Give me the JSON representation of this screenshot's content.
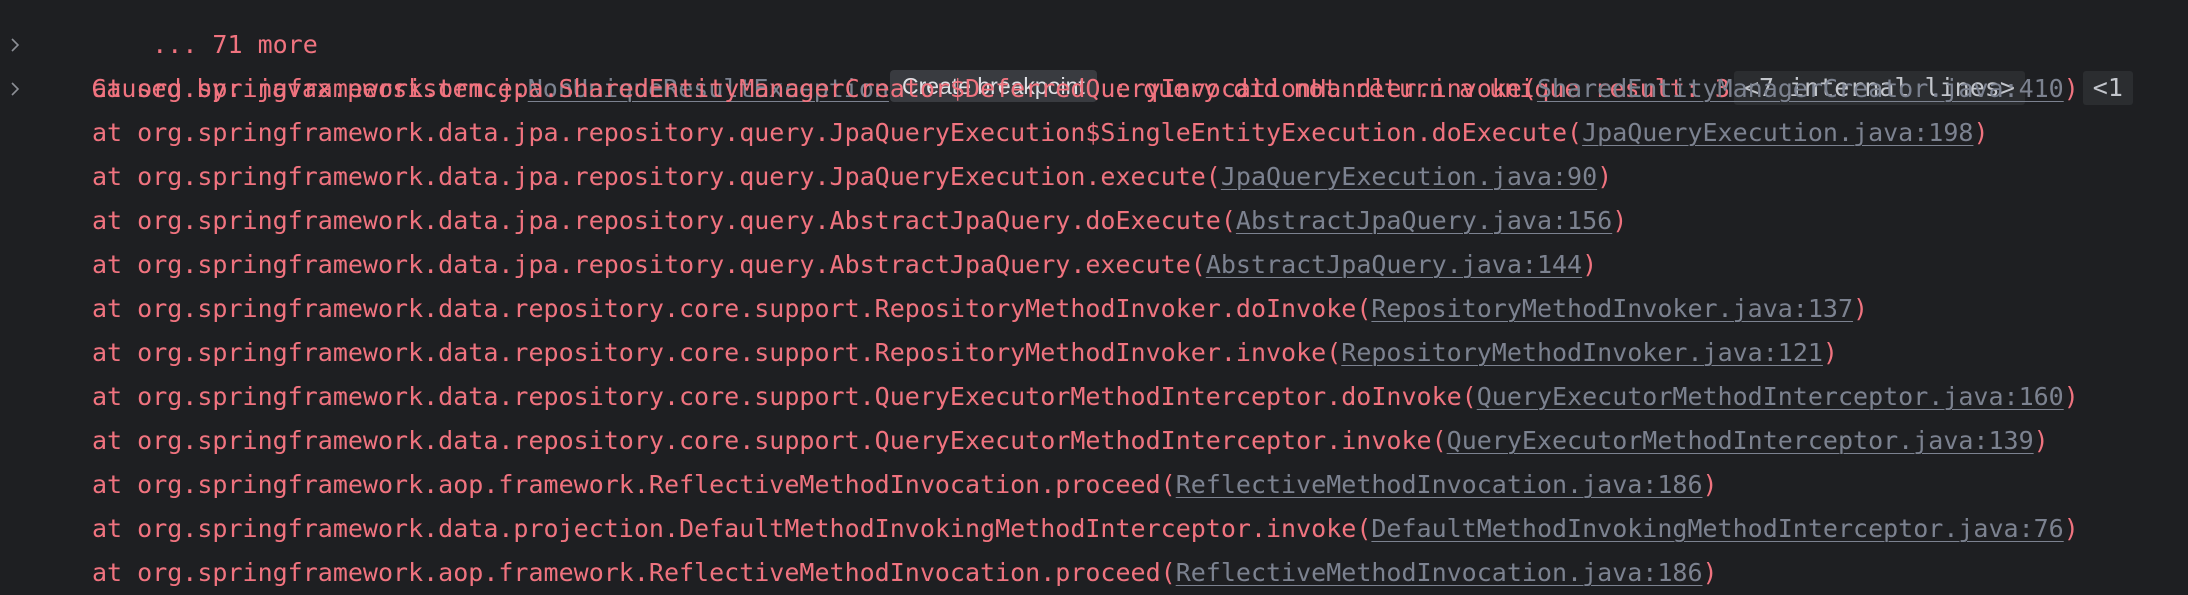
{
  "more_line": "... 71 more",
  "caused_by": {
    "prefix": "Caused by: javax.persistence.",
    "exception_link": "NonUniqueResultException",
    "tooltip": "Create breakpoint",
    "message": " : query did not return a unique result: 3",
    "internal_lines": "<7 internal lines>"
  },
  "frames": [
    {
      "method": "at org.springframework.orm.jpa.SharedEntityManagerCreator$DeferredQueryInvocationHandler.invoke",
      "location": "SharedEntityManagerCreator.java:410",
      "trailing": "<1"
    },
    {
      "method": "at org.springframework.data.jpa.repository.query.JpaQueryExecution$SingleEntityExecution.doExecute",
      "location": "JpaQueryExecution.java:198"
    },
    {
      "method": "at org.springframework.data.jpa.repository.query.JpaQueryExecution.execute",
      "location": "JpaQueryExecution.java:90"
    },
    {
      "method": "at org.springframework.data.jpa.repository.query.AbstractJpaQuery.doExecute",
      "location": "AbstractJpaQuery.java:156"
    },
    {
      "method": "at org.springframework.data.jpa.repository.query.AbstractJpaQuery.execute",
      "location": "AbstractJpaQuery.java:144"
    },
    {
      "method": "at org.springframework.data.repository.core.support.RepositoryMethodInvoker.doInvoke",
      "location": "RepositoryMethodInvoker.java:137"
    },
    {
      "method": "at org.springframework.data.repository.core.support.RepositoryMethodInvoker.invoke",
      "location": "RepositoryMethodInvoker.java:121"
    },
    {
      "method": "at org.springframework.data.repository.core.support.QueryExecutorMethodInterceptor.doInvoke",
      "location": "QueryExecutorMethodInterceptor.java:160"
    },
    {
      "method": "at org.springframework.data.repository.core.support.QueryExecutorMethodInterceptor.invoke",
      "location": "QueryExecutorMethodInterceptor.java:139"
    },
    {
      "method": "at org.springframework.aop.framework.ReflectiveMethodInvocation.proceed",
      "location": "ReflectiveMethodInvocation.java:186"
    },
    {
      "method": "at org.springframework.data.projection.DefaultMethodInvokingMethodInterceptor.invoke",
      "location": "DefaultMethodInvokingMethodInterceptor.java:76"
    },
    {
      "method": "at org.springframework.aop.framework.ReflectiveMethodInvocation.proceed",
      "location": "ReflectiveMethodInvocation.java:186"
    }
  ],
  "colors": {
    "background": "#1e1f22",
    "error_text": "#f0737f",
    "link_text": "#7c8290",
    "tooltip_bg": "#393b40",
    "tooltip_text": "#dfe1e5",
    "fold_bg": "#2b2d30"
  },
  "icons": {
    "fold": "chevron-right-icon"
  }
}
